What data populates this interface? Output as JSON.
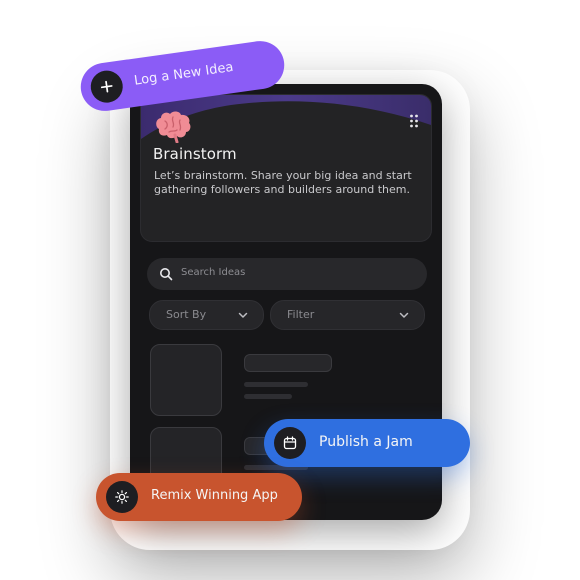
{
  "floating_actions": {
    "log_idea_label": "Log a New Idea",
    "publish_label": "Publish a Jam",
    "remix_label": "Remix Winning App"
  },
  "hero": {
    "title": "Brainstorm",
    "description": "Let’s brainstorm. Share your big idea and start gathering followers and builders around them.",
    "icon": "brain-icon"
  },
  "search": {
    "placeholder": "Search Ideas"
  },
  "filters": {
    "sort_label": "Sort By",
    "filter_label": "Filter"
  },
  "colors": {
    "log_idea": "#8b5cf6",
    "publish": "#2f6fe0",
    "remix": "#c8542e",
    "phone_bg": "#161618"
  }
}
